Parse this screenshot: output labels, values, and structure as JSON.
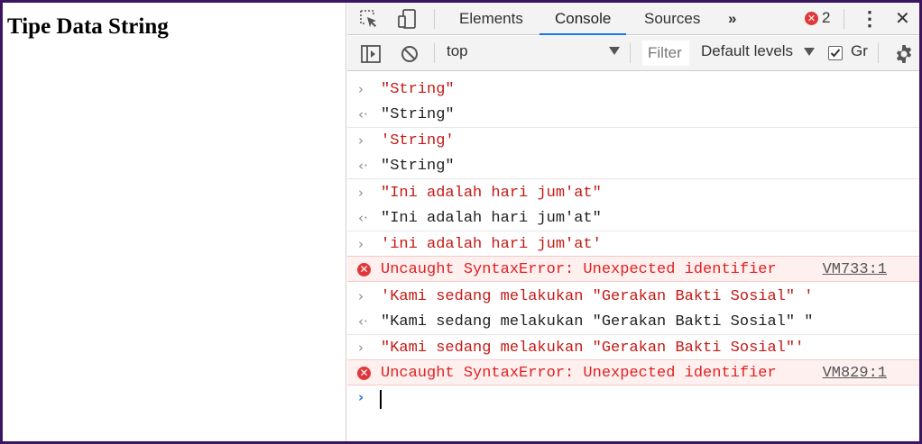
{
  "page": {
    "heading": "Tipe Data String"
  },
  "devtools": {
    "tabs": [
      "Elements",
      "Console",
      "Sources"
    ],
    "active_tab": "Console",
    "more_tabs_label": "»",
    "error_count": "2",
    "error_badge_glyph": "✕",
    "menu_glyph": "⋮",
    "close_glyph": "✕",
    "icons": {
      "inspect": "inspect-element-icon",
      "device": "device-toolbar-icon",
      "sidebar": "console-sidebar-icon",
      "clear": "clear-console-icon",
      "settings": "gear-icon"
    }
  },
  "toolbar": {
    "context": "top",
    "filter_placeholder": "Filter",
    "levels": "Default levels",
    "group_label": "Gr",
    "group_checked": true
  },
  "console": {
    "prompt_glyph": "›",
    "input_glyph": "›",
    "output_glyph": "‹·",
    "error_glyph": "✕",
    "entries": [
      {
        "kind": "in",
        "text": "\"String\""
      },
      {
        "kind": "out",
        "text": "\"String\""
      },
      {
        "kind": "in",
        "text": "'String'"
      },
      {
        "kind": "out",
        "text": "\"String\""
      },
      {
        "kind": "in",
        "text": "\"Ini adalah hari jum'at\""
      },
      {
        "kind": "out",
        "text": "\"Ini adalah hari jum'at\""
      },
      {
        "kind": "in",
        "text": "'ini adalah hari jum'at'"
      },
      {
        "kind": "err",
        "text": "Uncaught SyntaxError: Unexpected identifier",
        "source": "VM733:1"
      },
      {
        "kind": "in",
        "text": "'Kami sedang melakukan \"Gerakan Bakti Sosial\" '"
      },
      {
        "kind": "out",
        "text": "\"Kami sedang melakukan \"Gerakan Bakti Sosial\" \""
      },
      {
        "kind": "in",
        "text": "\"Kami sedang melakukan \"Gerakan Bakti Sosial\"'"
      },
      {
        "kind": "err",
        "text": "Uncaught SyntaxError: Unexpected identifier",
        "source": "VM829:1"
      }
    ]
  },
  "colors": {
    "accent": "#1a73e8",
    "error": "#e02020",
    "string": "#c41a16",
    "frame": "#3a1560"
  }
}
